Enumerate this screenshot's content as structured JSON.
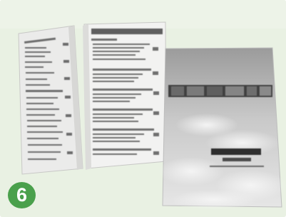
{
  "figure": {
    "step_badge": {
      "number": "6",
      "color": "#4aa04c"
    },
    "frame_background": "#e9f1e3",
    "cover_title_lines": [
      "自考书籍合订册",
      "教学大纲及说明"
    ]
  }
}
